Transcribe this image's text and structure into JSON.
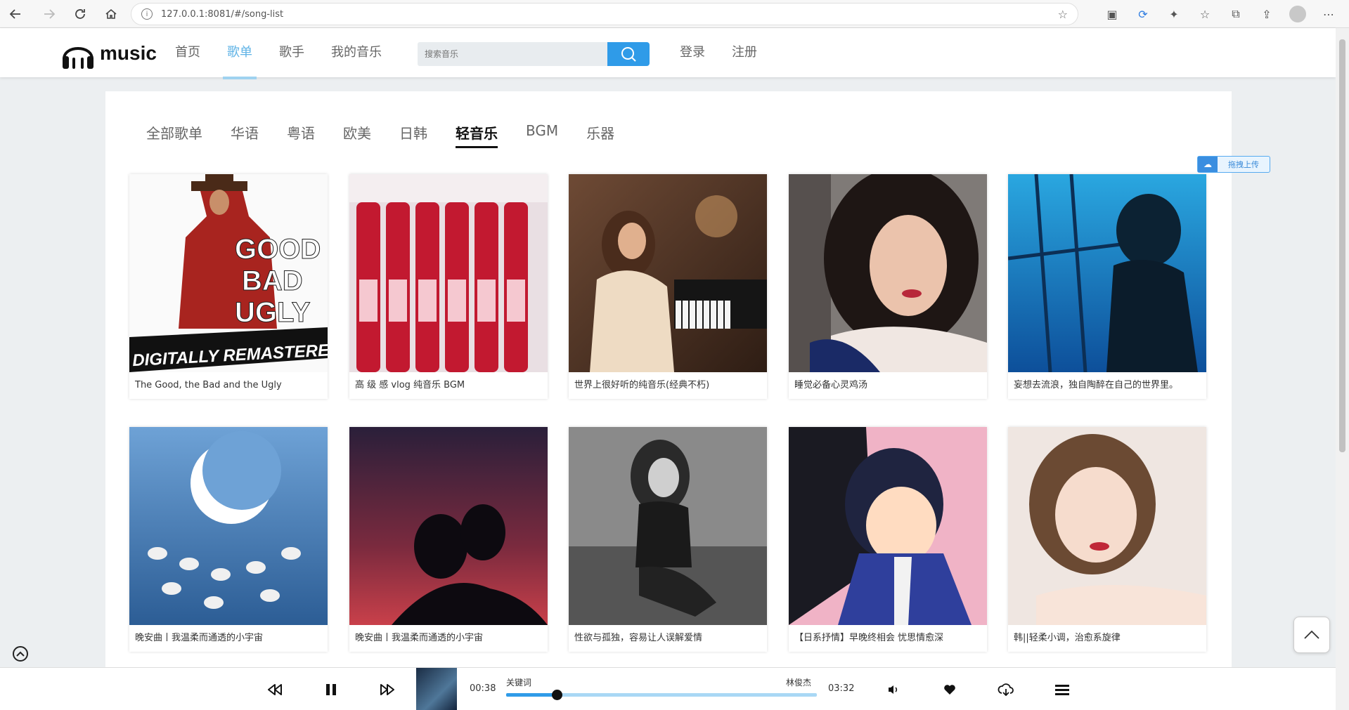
{
  "browser": {
    "url": "127.0.0.1:8081/#/song-list",
    "info_icon": "i"
  },
  "header": {
    "logo_text": "music",
    "nav": [
      {
        "label": "首页"
      },
      {
        "label": "歌单"
      },
      {
        "label": "歌手"
      },
      {
        "label": "我的音乐"
      }
    ],
    "active_nav": "歌单",
    "search_placeholder": "搜索音乐",
    "login_label": "登录",
    "register_label": "注册"
  },
  "categories": [
    "全部歌单",
    "华语",
    "粤语",
    "欧美",
    "日韩",
    "轻音乐",
    "BGM",
    "乐器"
  ],
  "active_category": "轻音乐",
  "upload": {
    "label": "拖拽上传"
  },
  "playlists": [
    {
      "title": "The Good, the Bad and the Ugly",
      "cover_text": "DIGITALLY REMASTERED"
    },
    {
      "title": "高 级 感 vlog 纯音乐 BGM"
    },
    {
      "title": "世界上很好听的纯音乐(经典不朽)"
    },
    {
      "title": "睡觉必备心灵鸡汤"
    },
    {
      "title": "妄想去流浪，独自陶醉在自己的世界里。"
    },
    {
      "title": "晚安曲丨我温柔而通透的小宇宙"
    },
    {
      "title": "晚安曲丨我温柔而通透的小宇宙"
    },
    {
      "title": "性欲与孤独，容易让人误解爱情"
    },
    {
      "title": "【日系抒情】早晚终相会 忧思情愈深"
    },
    {
      "title": "韩||轻柔小调，治愈系旋律"
    }
  ],
  "player": {
    "current_time": "00:38",
    "total_time": "03:32",
    "song_title": "关键词",
    "artist": "林俊杰",
    "progress_fraction": 0.162
  },
  "colors": {
    "accent": "#2f9be8",
    "active_nav": "#5fb3e6",
    "progress_track": "#a9d8f5"
  }
}
